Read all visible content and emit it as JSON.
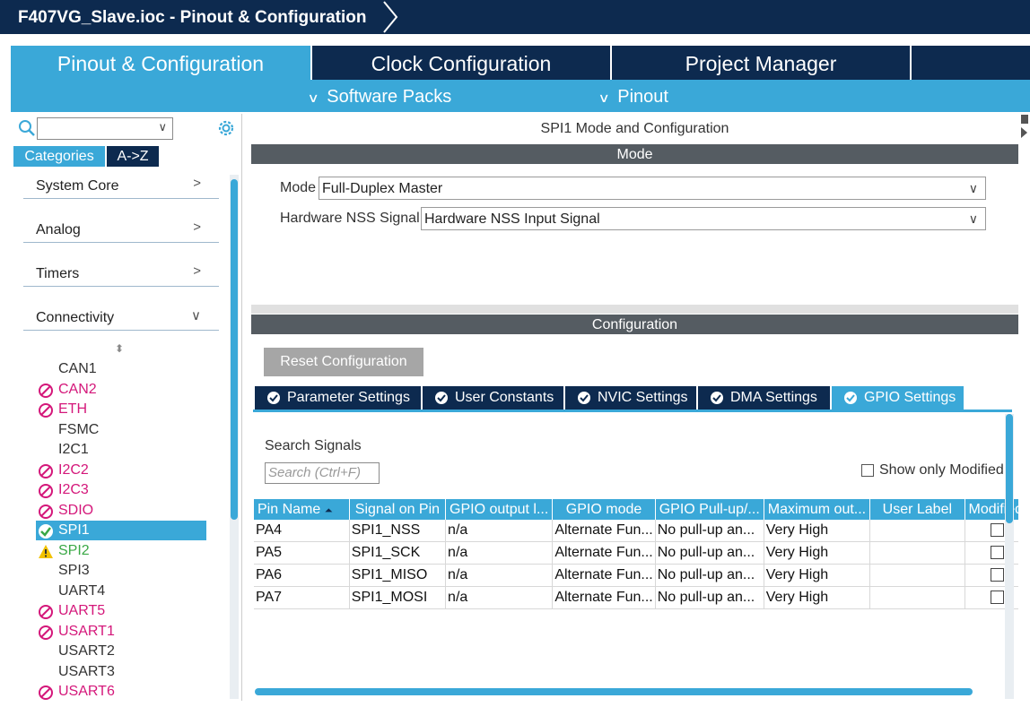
{
  "window": {
    "title": "F407VG_Slave.ioc - Pinout & Configuration"
  },
  "top_tabs": [
    {
      "label": "Pinout & Configuration",
      "active": true
    },
    {
      "label": "Clock Configuration",
      "active": false
    },
    {
      "label": "Project Manager",
      "active": false
    }
  ],
  "sub_menu": {
    "software_packs": "Software Packs",
    "pinout": "Pinout"
  },
  "left": {
    "search_value": "",
    "tabs": {
      "categories": "Categories",
      "az": "A->Z"
    },
    "categories": [
      {
        "label": "System Core",
        "expanded": false
      },
      {
        "label": "Analog",
        "expanded": false
      },
      {
        "label": "Timers",
        "expanded": false
      },
      {
        "label": "Connectivity",
        "expanded": true
      }
    ],
    "peripherals": [
      {
        "label": "CAN1",
        "status": "none"
      },
      {
        "label": "CAN2",
        "status": "disabled"
      },
      {
        "label": "ETH",
        "status": "disabled"
      },
      {
        "label": "FSMC",
        "status": "none"
      },
      {
        "label": "I2C1",
        "status": "none"
      },
      {
        "label": "I2C2",
        "status": "disabled"
      },
      {
        "label": "I2C3",
        "status": "disabled"
      },
      {
        "label": "SDIO",
        "status": "disabled"
      },
      {
        "label": "SPI1",
        "status": "ok"
      },
      {
        "label": "SPI2",
        "status": "warning"
      },
      {
        "label": "SPI3",
        "status": "none"
      },
      {
        "label": "UART4",
        "status": "none"
      },
      {
        "label": "UART5",
        "status": "disabled"
      },
      {
        "label": "USART1",
        "status": "disabled"
      },
      {
        "label": "USART2",
        "status": "none"
      },
      {
        "label": "USART3",
        "status": "none"
      },
      {
        "label": "USART6",
        "status": "disabled"
      }
    ]
  },
  "main": {
    "title": "SPI1 Mode and Configuration",
    "mode_header": "Mode",
    "mode_label": "Mode",
    "mode_value": "Full-Duplex Master",
    "nss_label": "Hardware NSS Signal",
    "nss_value": "Hardware NSS Input Signal",
    "config_header": "Configuration",
    "reset_button": "Reset Configuration",
    "config_tabs": [
      "Parameter Settings",
      "User Constants",
      "NVIC Settings",
      "DMA Settings",
      "GPIO Settings"
    ],
    "active_config_tab": "GPIO Settings",
    "search_signals_label": "Search Signals",
    "search_signals_placeholder": "Search (Ctrl+F)",
    "show_only_modified": "Show only Modified",
    "table": {
      "headers": [
        "Pin Name",
        "Signal on Pin",
        "GPIO output l...",
        "GPIO mode",
        "GPIO Pull-up/...",
        "Maximum out...",
        "User Label",
        "Modified"
      ],
      "rows": [
        [
          "PA4",
          "SPI1_NSS",
          "n/a",
          "Alternate Fun...",
          "No pull-up an...",
          "Very High",
          "",
          false
        ],
        [
          "PA5",
          "SPI1_SCK",
          "n/a",
          "Alternate Fun...",
          "No pull-up an...",
          "Very High",
          "",
          false
        ],
        [
          "PA6",
          "SPI1_MISO",
          "n/a",
          "Alternate Fun...",
          "No pull-up an...",
          "Very High",
          "",
          false
        ],
        [
          "PA7",
          "SPI1_MOSI",
          "n/a",
          "Alternate Fun...",
          "No pull-up an...",
          "Very High",
          "",
          false
        ]
      ]
    }
  },
  "colors": {
    "navy": "#0d2a4f",
    "accent": "#3aa8d8",
    "disabled": "#d4177a",
    "ok": "#39a845",
    "warning": "#f2c200"
  }
}
